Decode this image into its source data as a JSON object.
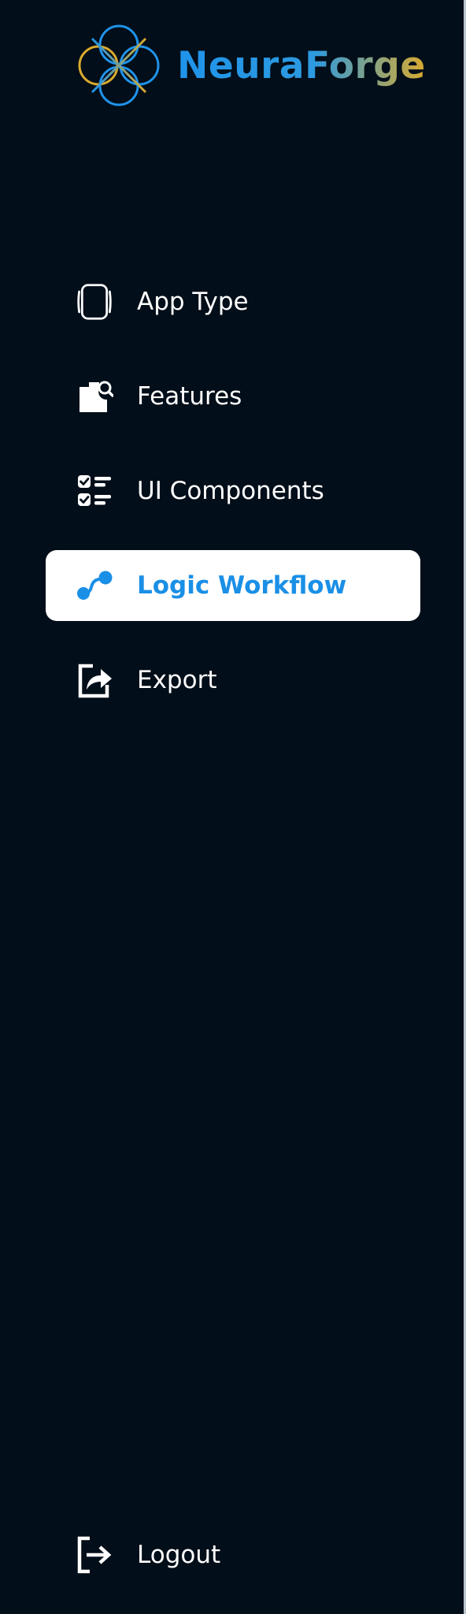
{
  "brand": {
    "name": "NeuraForge"
  },
  "colors": {
    "sidebar_bg": "#020e19",
    "accent": "#1a8fe6",
    "brand_gold": "#d9aa2e",
    "text": "#ffffff"
  },
  "nav": {
    "items": [
      {
        "label": "App Type",
        "icon": "mobile-device-icon",
        "active": false
      },
      {
        "label": "Features",
        "icon": "document-search-icon",
        "active": false
      },
      {
        "label": "UI Components",
        "icon": "checklist-icon",
        "active": false
      },
      {
        "label": "Logic Workflow",
        "icon": "workflow-nodes-icon",
        "active": true
      },
      {
        "label": "Export",
        "icon": "share-export-icon",
        "active": false
      }
    ]
  },
  "footer": {
    "logout_label": "Logout",
    "logout_icon": "logout-icon"
  }
}
